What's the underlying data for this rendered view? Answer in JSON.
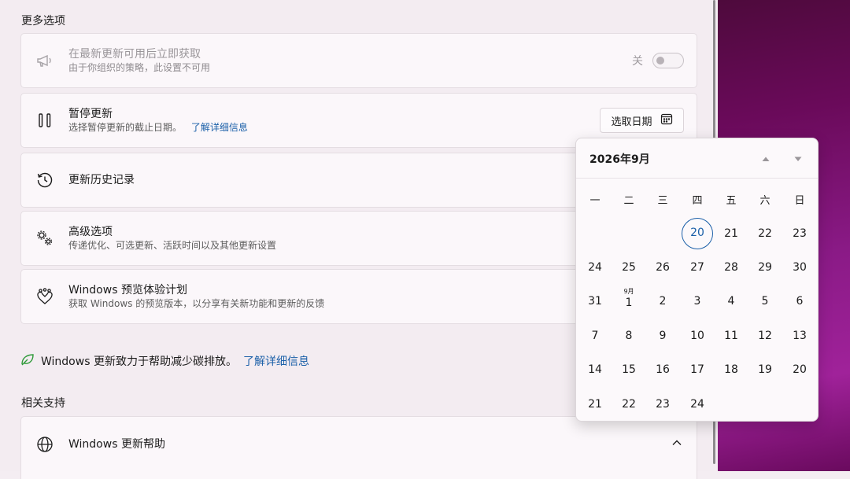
{
  "more_options": {
    "title": "更多选项",
    "get_latest": {
      "title": "在最新更新可用后立即获取",
      "subtitle": "由于你组织的策略，此设置不可用",
      "toggle_state": "关",
      "icon": "megaphone-icon"
    },
    "pause": {
      "title": "暂停更新",
      "subtitle": "选择暂停更新的截止日期。",
      "link": "了解详细信息",
      "button": "选取日期",
      "icon": "pause-icon"
    },
    "history": {
      "title": "更新历史记录",
      "icon": "history-icon"
    },
    "advanced": {
      "title": "高级选项",
      "subtitle": "传递优化、可选更新、活跃时间以及其他更新设置",
      "icon": "gears-icon"
    },
    "insider": {
      "title": "Windows 预览体验计划",
      "subtitle": "获取 Windows 的预览版本，以分享有关新功能和更新的反馈",
      "icon": "insider-hearts-icon"
    }
  },
  "eco": {
    "text": "Windows 更新致力于帮助减少碳排放。",
    "link": "了解详细信息",
    "icon": "leaf-icon"
  },
  "support": {
    "title": "相关支持",
    "help": {
      "title": "Windows 更新帮助",
      "icon": "globe-icon"
    }
  },
  "calendar": {
    "header": "2026年9月",
    "weekdays": [
      "一",
      "二",
      "三",
      "四",
      "五",
      "六",
      "日"
    ],
    "month_tag": "9月",
    "today": "20",
    "days": [
      [
        "",
        "",
        "",
        "20",
        "21",
        "22",
        "23"
      ],
      [
        "24",
        "25",
        "26",
        "27",
        "28",
        "29",
        "30"
      ],
      [
        "31",
        "1",
        "2",
        "3",
        "4",
        "5",
        "6"
      ],
      [
        "7",
        "8",
        "9",
        "10",
        "11",
        "12",
        "13"
      ],
      [
        "14",
        "15",
        "16",
        "17",
        "18",
        "19",
        "20"
      ],
      [
        "21",
        "22",
        "23",
        "24",
        "",
        "",
        ""
      ]
    ]
  },
  "colors": {
    "accent": "#1a5fa8",
    "link": "#1a5fa8"
  }
}
